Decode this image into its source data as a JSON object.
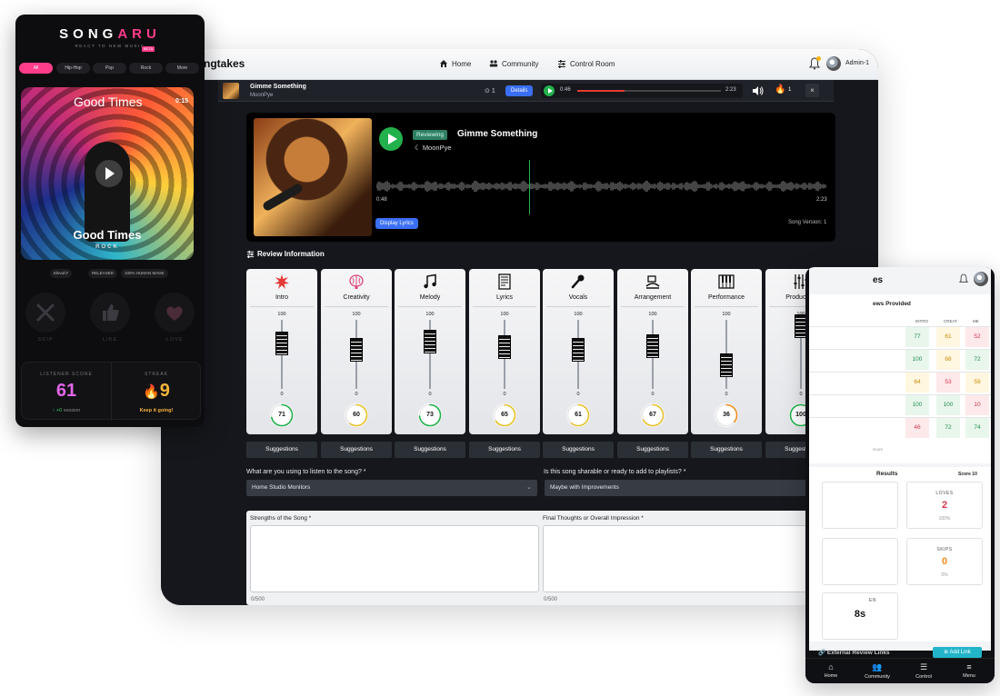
{
  "desktop": {
    "brand": "ngtakes",
    "nav": [
      {
        "label": "Home",
        "icon": "home-icon"
      },
      {
        "label": "Community",
        "icon": "community-icon"
      },
      {
        "label": "Control Room",
        "icon": "sliders-icon"
      }
    ],
    "user": "Admin-1",
    "player": {
      "title": "Gimme Something",
      "artist": "MoonPye",
      "count": "1",
      "details_label": "Details",
      "time_current": "0:46",
      "time_total": "2:23",
      "progress": 0.33,
      "fire_count": "1",
      "close_label": "×"
    },
    "hero": {
      "status": "Reviewing",
      "title": "Gimme Something",
      "artist": "MoonPye",
      "time_start": "0:48",
      "time_end": "2:23",
      "lyrics_button": "Display Lyrics",
      "version": "Song Version: 1"
    },
    "review_header": "Review Information",
    "categories": [
      {
        "label": "Intro",
        "max": "100",
        "min": "0",
        "score": 71,
        "color": "#22b14c",
        "icon": "burst-icon"
      },
      {
        "label": "Creativity",
        "max": "100",
        "min": "0",
        "score": 60,
        "color": "#e8c22a",
        "icon": "brain-icon"
      },
      {
        "label": "Melody",
        "max": "100",
        "min": "0",
        "score": 73,
        "color": "#22b14c",
        "icon": "music-note-icon"
      },
      {
        "label": "Lyrics",
        "max": "100",
        "min": "0",
        "score": 65,
        "color": "#e8c22a",
        "icon": "lyrics-sheet-icon"
      },
      {
        "label": "Vocals",
        "max": "100",
        "min": "0",
        "score": 61,
        "color": "#e8c22a",
        "icon": "microphone-icon"
      },
      {
        "label": "Arrangement",
        "max": "100",
        "min": "0",
        "score": 67,
        "color": "#e8c22a",
        "icon": "arrangement-icon"
      },
      {
        "label": "Performance",
        "max": "100",
        "min": "0",
        "score": 36,
        "color": "#f08c1e",
        "icon": "piano-icon"
      },
      {
        "label": "Production",
        "max": "100",
        "min": "0",
        "score": 100,
        "color": "#22b14c",
        "icon": "mixer-icon"
      }
    ],
    "suggestions_label": "Suggestions",
    "questions": {
      "listen_q": "What are you using to listen to the song? *",
      "listen_a": "Home Studio Monitors",
      "share_q": "Is this song sharable or ready to add to playlists? *",
      "share_a": "Maybe with Improvements"
    },
    "textareas": {
      "strengths_label": "Strengths of the Song *",
      "thoughts_label": "Final Thoughts or Overall Impression *",
      "strengths_count": "0/500",
      "thoughts_count": "0/500"
    }
  },
  "mobile": {
    "logo_a": "SONG",
    "logo_b": "ARU",
    "tagline": "REACT TO NEW MUSIC",
    "beta": "BETA",
    "genres": [
      "All",
      "Hip-Hop",
      "Pop",
      "Rock",
      "More"
    ],
    "art_title": "Good Times",
    "duration": "0:15",
    "song_title": "Good Times",
    "genre_tag": "ROCK",
    "pills": [
      "Elevoh7",
      "RELEASED",
      "100% HUMAN MADE"
    ],
    "actions": [
      "SKIP",
      "LIKE",
      "LOVE"
    ],
    "listener_score_label": "LISTENER SCORE",
    "listener_score": "61",
    "session_delta": "↑ +0",
    "session_label": "session",
    "streak_label": "STREAK",
    "streak": "9",
    "streak_note": "Keep it going!"
  },
  "tablet": {
    "title": "es",
    "reviews_title": "ews Provided",
    "columns": [
      "INTRO",
      "CREAT.",
      "ME"
    ],
    "rows": [
      [
        "77",
        "61",
        "52"
      ],
      [
        "100",
        "68",
        "72"
      ],
      [
        "64",
        "53",
        "59"
      ],
      [
        "100",
        "100",
        "10"
      ],
      [
        "46",
        "72",
        "74"
      ]
    ],
    "footer_note": "score",
    "results_title": "Results",
    "score": "Score 10",
    "loves_label": "LOVES",
    "loves_value": "2",
    "loves_pct": "100%",
    "skips_label": "SKIPS",
    "skips_value": "0",
    "skips_pct": "0%",
    "time_label": "EN",
    "time_value": "8s",
    "external_links": "External Review Links",
    "add_link": "Add Link",
    "bottom_nav": [
      {
        "label": "Home",
        "icon": "home-icon"
      },
      {
        "label": "Community",
        "icon": "community-icon"
      },
      {
        "label": "Control",
        "icon": "sliders-icon"
      },
      {
        "label": "Menu",
        "icon": "menu-icon"
      }
    ]
  }
}
